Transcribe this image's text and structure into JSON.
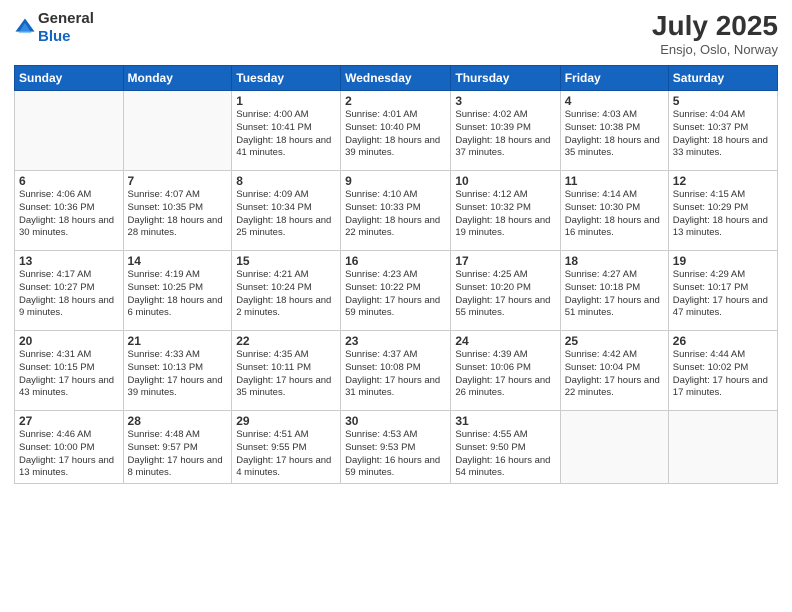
{
  "header": {
    "logo_general": "General",
    "logo_blue": "Blue",
    "month_year": "July 2025",
    "location": "Ensjo, Oslo, Norway"
  },
  "weekdays": [
    "Sunday",
    "Monday",
    "Tuesday",
    "Wednesday",
    "Thursday",
    "Friday",
    "Saturday"
  ],
  "weeks": [
    [
      {
        "day": "",
        "info": ""
      },
      {
        "day": "",
        "info": ""
      },
      {
        "day": "1",
        "info": "Sunrise: 4:00 AM\nSunset: 10:41 PM\nDaylight: 18 hours\nand 41 minutes."
      },
      {
        "day": "2",
        "info": "Sunrise: 4:01 AM\nSunset: 10:40 PM\nDaylight: 18 hours\nand 39 minutes."
      },
      {
        "day": "3",
        "info": "Sunrise: 4:02 AM\nSunset: 10:39 PM\nDaylight: 18 hours\nand 37 minutes."
      },
      {
        "day": "4",
        "info": "Sunrise: 4:03 AM\nSunset: 10:38 PM\nDaylight: 18 hours\nand 35 minutes."
      },
      {
        "day": "5",
        "info": "Sunrise: 4:04 AM\nSunset: 10:37 PM\nDaylight: 18 hours\nand 33 minutes."
      }
    ],
    [
      {
        "day": "6",
        "info": "Sunrise: 4:06 AM\nSunset: 10:36 PM\nDaylight: 18 hours\nand 30 minutes."
      },
      {
        "day": "7",
        "info": "Sunrise: 4:07 AM\nSunset: 10:35 PM\nDaylight: 18 hours\nand 28 minutes."
      },
      {
        "day": "8",
        "info": "Sunrise: 4:09 AM\nSunset: 10:34 PM\nDaylight: 18 hours\nand 25 minutes."
      },
      {
        "day": "9",
        "info": "Sunrise: 4:10 AM\nSunset: 10:33 PM\nDaylight: 18 hours\nand 22 minutes."
      },
      {
        "day": "10",
        "info": "Sunrise: 4:12 AM\nSunset: 10:32 PM\nDaylight: 18 hours\nand 19 minutes."
      },
      {
        "day": "11",
        "info": "Sunrise: 4:14 AM\nSunset: 10:30 PM\nDaylight: 18 hours\nand 16 minutes."
      },
      {
        "day": "12",
        "info": "Sunrise: 4:15 AM\nSunset: 10:29 PM\nDaylight: 18 hours\nand 13 minutes."
      }
    ],
    [
      {
        "day": "13",
        "info": "Sunrise: 4:17 AM\nSunset: 10:27 PM\nDaylight: 18 hours\nand 9 minutes."
      },
      {
        "day": "14",
        "info": "Sunrise: 4:19 AM\nSunset: 10:25 PM\nDaylight: 18 hours\nand 6 minutes."
      },
      {
        "day": "15",
        "info": "Sunrise: 4:21 AM\nSunset: 10:24 PM\nDaylight: 18 hours\nand 2 minutes."
      },
      {
        "day": "16",
        "info": "Sunrise: 4:23 AM\nSunset: 10:22 PM\nDaylight: 17 hours\nand 59 minutes."
      },
      {
        "day": "17",
        "info": "Sunrise: 4:25 AM\nSunset: 10:20 PM\nDaylight: 17 hours\nand 55 minutes."
      },
      {
        "day": "18",
        "info": "Sunrise: 4:27 AM\nSunset: 10:18 PM\nDaylight: 17 hours\nand 51 minutes."
      },
      {
        "day": "19",
        "info": "Sunrise: 4:29 AM\nSunset: 10:17 PM\nDaylight: 17 hours\nand 47 minutes."
      }
    ],
    [
      {
        "day": "20",
        "info": "Sunrise: 4:31 AM\nSunset: 10:15 PM\nDaylight: 17 hours\nand 43 minutes."
      },
      {
        "day": "21",
        "info": "Sunrise: 4:33 AM\nSunset: 10:13 PM\nDaylight: 17 hours\nand 39 minutes."
      },
      {
        "day": "22",
        "info": "Sunrise: 4:35 AM\nSunset: 10:11 PM\nDaylight: 17 hours\nand 35 minutes."
      },
      {
        "day": "23",
        "info": "Sunrise: 4:37 AM\nSunset: 10:08 PM\nDaylight: 17 hours\nand 31 minutes."
      },
      {
        "day": "24",
        "info": "Sunrise: 4:39 AM\nSunset: 10:06 PM\nDaylight: 17 hours\nand 26 minutes."
      },
      {
        "day": "25",
        "info": "Sunrise: 4:42 AM\nSunset: 10:04 PM\nDaylight: 17 hours\nand 22 minutes."
      },
      {
        "day": "26",
        "info": "Sunrise: 4:44 AM\nSunset: 10:02 PM\nDaylight: 17 hours\nand 17 minutes."
      }
    ],
    [
      {
        "day": "27",
        "info": "Sunrise: 4:46 AM\nSunset: 10:00 PM\nDaylight: 17 hours\nand 13 minutes."
      },
      {
        "day": "28",
        "info": "Sunrise: 4:48 AM\nSunset: 9:57 PM\nDaylight: 17 hours\nand 8 minutes."
      },
      {
        "day": "29",
        "info": "Sunrise: 4:51 AM\nSunset: 9:55 PM\nDaylight: 17 hours\nand 4 minutes."
      },
      {
        "day": "30",
        "info": "Sunrise: 4:53 AM\nSunset: 9:53 PM\nDaylight: 16 hours\nand 59 minutes."
      },
      {
        "day": "31",
        "info": "Sunrise: 4:55 AM\nSunset: 9:50 PM\nDaylight: 16 hours\nand 54 minutes."
      },
      {
        "day": "",
        "info": ""
      },
      {
        "day": "",
        "info": ""
      }
    ]
  ]
}
